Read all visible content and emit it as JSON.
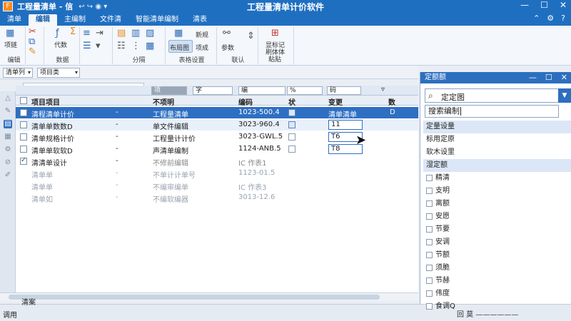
{
  "titlebar": {
    "app_icon": "F",
    "doc": "工程量清单 - 信",
    "quick_access": "↩ ↪ ◉ ▾",
    "title": "工程量清单计价软件",
    "minimize": "—",
    "maximize": "☐",
    "close": "✕"
  },
  "tabs": [
    "清单",
    "编辑",
    "主编制",
    "文件清",
    "智能清单编制",
    "清表"
  ],
  "active_tab": 1,
  "tabbar_right": [
    "⌃",
    "⚙",
    "?"
  ],
  "ribbon": {
    "groups": [
      {
        "label": "编辑"
      },
      {
        "label": "数据"
      },
      {
        "label": "分隔"
      },
      {
        "label": "表格设置"
      },
      {
        "label": "联认"
      },
      {
        "label": ""
      }
    ],
    "labels": {
      "g1a": "项链",
      "g2a": "代数",
      "g4a": "布局图",
      "g4b": "新规",
      "g4c": "项成",
      "g5a": "参数",
      "g6a": "显标记",
      "g6b": "刷体体",
      "g6c": "粘贴"
    }
  },
  "toolbar2": {
    "combo1": "清单列",
    "combo2": "项目类"
  },
  "grid": {
    "filters": [
      "项",
      "字",
      "编",
      "%",
      "码",
      "▿"
    ],
    "headers": [
      "项目项目",
      "不项明",
      "编码",
      "状",
      "变更",
      "数"
    ],
    "rows": [
      {
        "name": "清程清单计价",
        "dash": "-",
        "desc": "工程量清单",
        "code": "1023-500.4",
        "value": "清单清单",
        "flag": "D"
      },
      {
        "name": "清单单数数D",
        "dash": "-",
        "desc": "单文件编辑",
        "code": "3023-960.4",
        "value": "11",
        "flag": ""
      },
      {
        "name": "清单规格计价",
        "dash": "-",
        "desc": "工程量计计价",
        "code": "3023-GWL.5",
        "value": "T6",
        "flag": ""
      },
      {
        "name": "清单单软软D",
        "dash": "-",
        "desc": "声清单编制",
        "code": "1124-ANB.5",
        "value": "T8",
        "flag": ""
      },
      {
        "name": "清清单设计",
        "dash": "-",
        "desc": "不修前编辑",
        "code": "",
        "value": "IC  作表1",
        "flag": ""
      },
      {
        "name": "清单单",
        "dash": "-",
        "desc": "不单计计单号",
        "code": "1123-01.5",
        "value": "",
        "flag": ""
      },
      {
        "name": "清单单",
        "dash": "-",
        "desc": "不编审编单",
        "code": "",
        "value": "IC  作表3",
        "flag": ""
      },
      {
        "name": "清单如",
        "dash": "-",
        "desc": "不编软编器",
        "code": "3013-12.6",
        "value": "",
        "flag": ""
      }
    ]
  },
  "statusbar": {
    "left_top": "清案",
    "left_bottom": "调用"
  },
  "panel": {
    "title": "定额额",
    "combo_text": "定定图",
    "input_text": "搜索编制",
    "items": [
      {
        "label": "定量设量",
        "checkbox": false,
        "hl": true
      },
      {
        "label": "标用定原",
        "checkbox": false,
        "hl": false
      },
      {
        "label": "软木设里",
        "checkbox": false,
        "hl": false
      },
      {
        "label": "湿定额",
        "checkbox": false,
        "hl": true
      },
      {
        "label": "精清",
        "checkbox": true,
        "hl": false
      },
      {
        "label": "支明",
        "checkbox": true,
        "hl": false
      },
      {
        "label": "离额",
        "checkbox": true,
        "hl": false
      },
      {
        "label": "安愿",
        "checkbox": true,
        "hl": false
      },
      {
        "label": "节要",
        "checkbox": true,
        "hl": false
      },
      {
        "label": "安调",
        "checkbox": true,
        "hl": false
      },
      {
        "label": "节额",
        "checkbox": true,
        "hl": false
      },
      {
        "label": "须脆",
        "checkbox": true,
        "hl": false
      },
      {
        "label": "节赫",
        "checkbox": true,
        "hl": false
      },
      {
        "label": "伟度",
        "checkbox": true,
        "hl": false
      },
      {
        "label": "食调Q",
        "checkbox": true,
        "hl": false
      }
    ],
    "footer": "回 莫 ——————"
  }
}
